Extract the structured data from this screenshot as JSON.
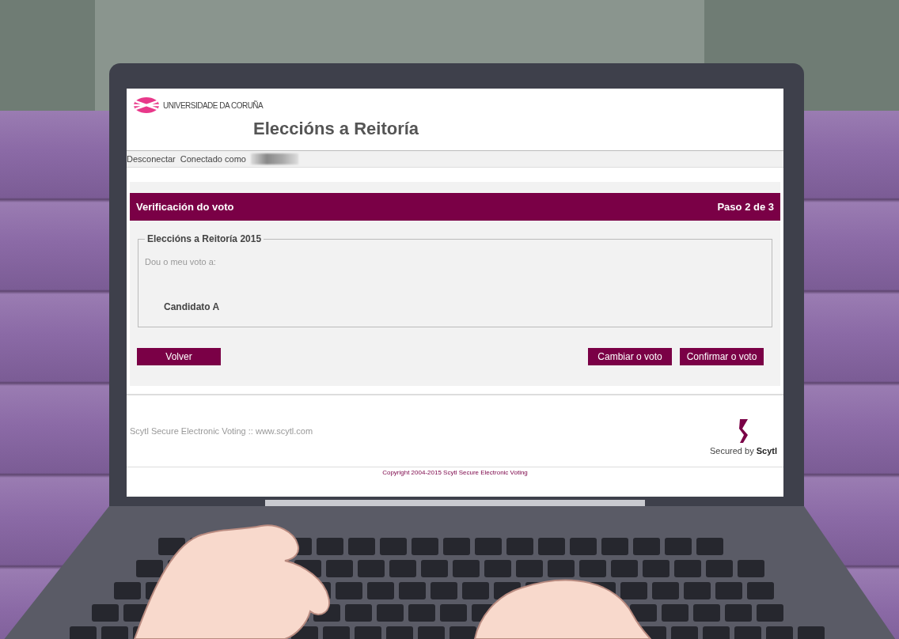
{
  "header": {
    "logo_text": "UNIVERSIDADE DA CORUÑA",
    "title": "Eleccións a Reitoría"
  },
  "user_bar": {
    "link": "Desconectar",
    "label": "Conectado como"
  },
  "step_bar": {
    "title": "Verificación do voto",
    "step": "Paso 2 de 3"
  },
  "election": {
    "legend": "Eleccións a Reitoría 2015",
    "prompt": "Dou o meu voto a:",
    "choice": "Candidato A"
  },
  "buttons": {
    "left": [
      "Volver"
    ],
    "right": [
      "Cambiar o voto",
      "Confirmar o voto"
    ]
  },
  "footer": {
    "text": "Scytl Secure Electronic Voting :: www.scytl.com",
    "badge": "Secured by **Scytl**",
    "copyright": "Copyright 2004-2015 Scytl Secure Electronic Voting"
  }
}
